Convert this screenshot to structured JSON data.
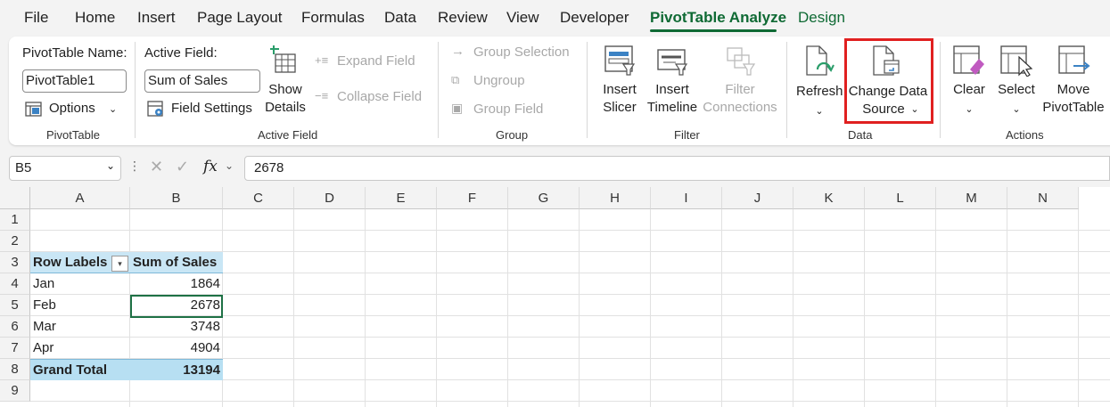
{
  "menu": {
    "tabs": [
      {
        "label": "File"
      },
      {
        "label": "Home"
      },
      {
        "label": "Insert"
      },
      {
        "label": "Page Layout"
      },
      {
        "label": "Formulas"
      },
      {
        "label": "Data"
      },
      {
        "label": "Review"
      },
      {
        "label": "View"
      },
      {
        "label": "Developer"
      },
      {
        "label": "PivotTable Analyze"
      },
      {
        "label": "Design"
      }
    ]
  },
  "ribbon": {
    "pivottable": {
      "name_label": "PivotTable Name:",
      "name_value": "PivotTable1",
      "options_label": "Options",
      "group_label": "PivotTable"
    },
    "active_field": {
      "label": "Active Field:",
      "value": "Sum of Sales",
      "field_settings": "Field Settings",
      "show_details_1": "Show",
      "show_details_2": "Details",
      "expand_field": "Expand Field",
      "collapse_field": "Collapse Field",
      "group_label": "Active Field"
    },
    "group": {
      "group_selection": "Group Selection",
      "ungroup": "Ungroup",
      "group_field": "Group Field",
      "group_label": "Group"
    },
    "filter": {
      "insert_slicer_1": "Insert",
      "insert_slicer_2": "Slicer",
      "insert_timeline_1": "Insert",
      "insert_timeline_2": "Timeline",
      "filter_connections_1": "Filter",
      "filter_connections_2": "Connections",
      "group_label": "Filter"
    },
    "data": {
      "refresh": "Refresh",
      "change_source_1": "Change Data",
      "change_source_2": "Source",
      "group_label": "Data"
    },
    "actions": {
      "clear": "Clear",
      "select": "Select",
      "move_1": "Move",
      "move_2": "PivotTable",
      "group_label": "Actions"
    }
  },
  "formula_bar": {
    "name_box": "B5",
    "fx": "fx",
    "value": "2678"
  },
  "sheet": {
    "columns": [
      "A",
      "B",
      "C",
      "D",
      "E",
      "F",
      "G",
      "H",
      "I",
      "J",
      "K",
      "L",
      "M",
      "N"
    ],
    "rows": [
      "1",
      "2",
      "3",
      "4",
      "5",
      "6",
      "7",
      "8",
      "9"
    ],
    "pivot": {
      "header_label": "Row Labels",
      "header_value": "Sum of Sales",
      "rows": [
        {
          "label": "Jan",
          "value": "1864"
        },
        {
          "label": "Feb",
          "value": "2678"
        },
        {
          "label": "Mar",
          "value": "3748"
        },
        {
          "label": "Apr",
          "value": "4904"
        }
      ],
      "total_label": "Grand Total",
      "total_value": "13194"
    }
  },
  "colors": {
    "accent_green": "#0f6a34",
    "highlight_red": "#e02020",
    "pivot_header_blue": "#c9e6f5"
  }
}
